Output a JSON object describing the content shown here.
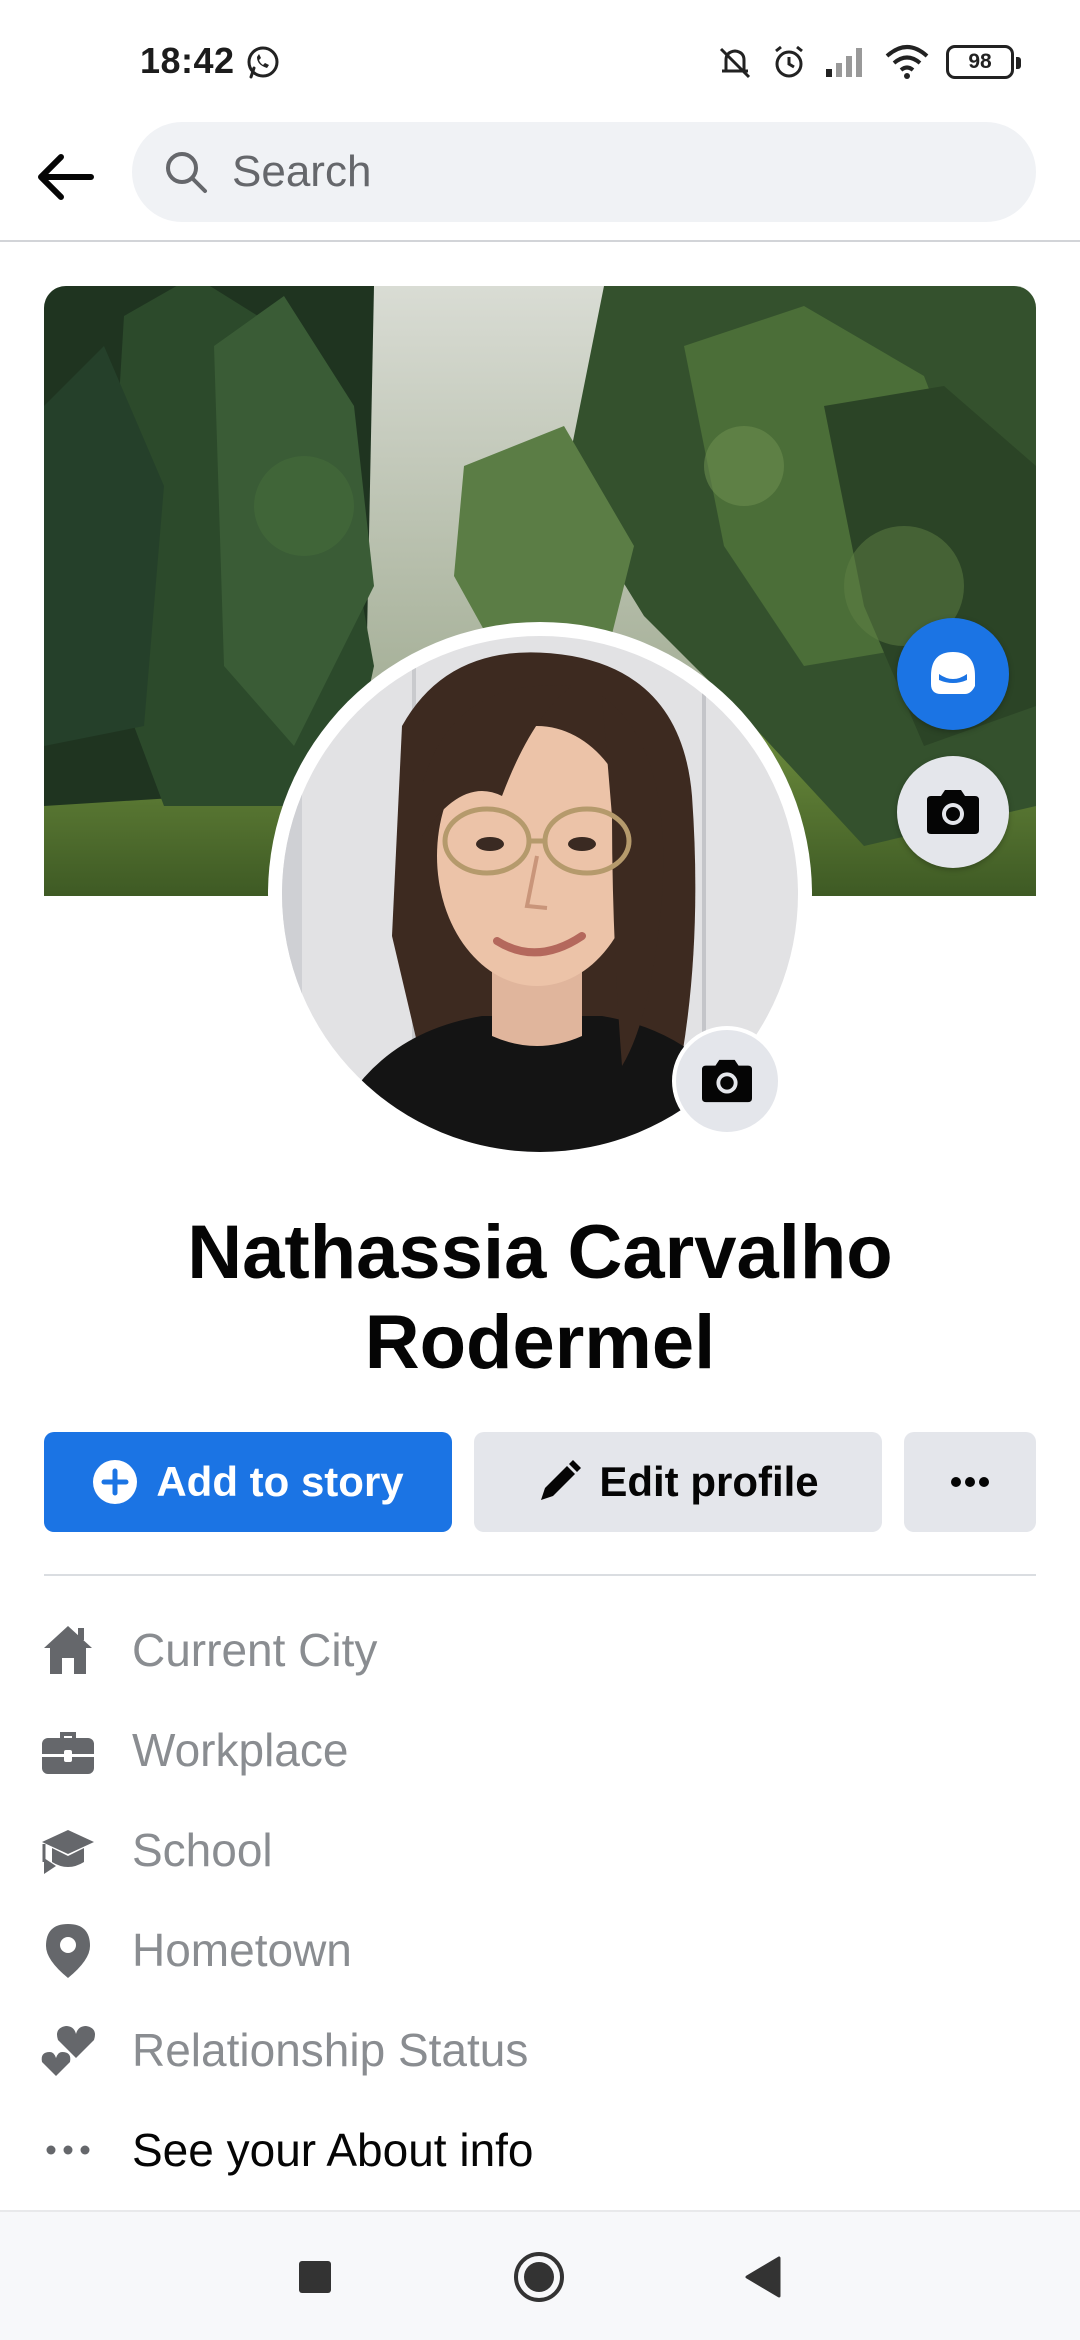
{
  "status_bar": {
    "time": "18:42",
    "battery": "98",
    "icons": [
      "whatsapp-icon",
      "silent-icon",
      "alarm-icon",
      "signal-icon",
      "wifi-icon",
      "battery-icon"
    ]
  },
  "header": {
    "back_icon": "arrow-left-icon",
    "search_placeholder": "Search"
  },
  "profile": {
    "name": "Nathassia Carvalho Rodermel",
    "cover_photo": "forest-path-photo",
    "profile_photo": "profile-selfie-photo"
  },
  "actions": {
    "add_story_label": "Add to story",
    "edit_profile_label": "Edit profile",
    "more_icon": "ellipsis-icon"
  },
  "intro": [
    {
      "icon": "home-icon",
      "label": "Current City"
    },
    {
      "icon": "briefcase-icon",
      "label": "Workplace"
    },
    {
      "icon": "graduation-cap-icon",
      "label": "School"
    },
    {
      "icon": "location-pin-icon",
      "label": "Hometown"
    },
    {
      "icon": "hearts-icon",
      "label": "Relationship Status"
    },
    {
      "icon": "ellipsis-icon",
      "label": "See your About info"
    }
  ],
  "nav": [
    "recents-square-icon",
    "home-circle-icon",
    "back-triangle-icon"
  ],
  "colors": {
    "primary_blue": "#1b74e4",
    "button_gray": "#e4e6eb",
    "secondary_text": "#8a8d91"
  }
}
